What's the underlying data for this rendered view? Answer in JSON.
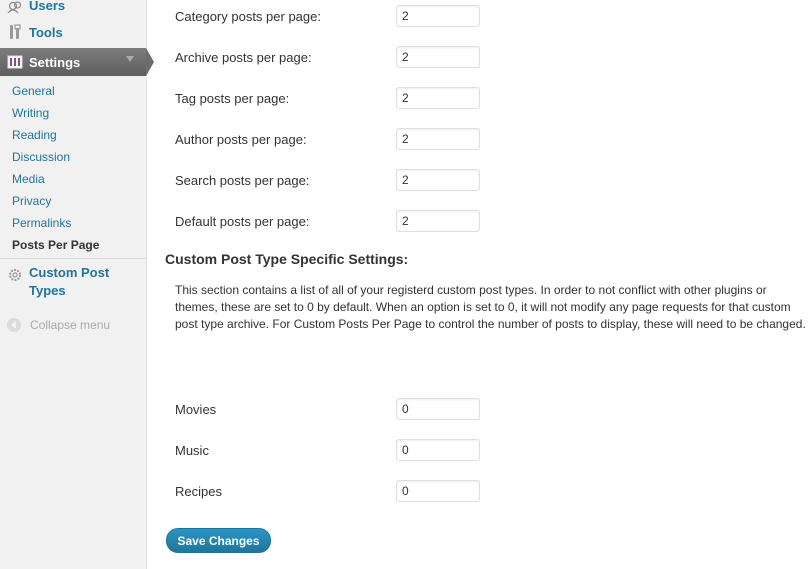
{
  "sidebar": {
    "users_label": "Users",
    "tools_label": "Tools",
    "settings_label": "Settings",
    "submenu": [
      {
        "label": "General",
        "current": false
      },
      {
        "label": "Writing",
        "current": false
      },
      {
        "label": "Reading",
        "current": false
      },
      {
        "label": "Discussion",
        "current": false
      },
      {
        "label": "Media",
        "current": false
      },
      {
        "label": "Privacy",
        "current": false
      },
      {
        "label": "Permalinks",
        "current": false
      },
      {
        "label": "Posts Per Page",
        "current": true
      }
    ],
    "custom_post_types_label": "Custom Post Types",
    "collapse_label": "Collapse menu",
    "icons": {
      "users": "users-icon",
      "tools": "tools-icon",
      "settings": "settings-icon",
      "custom_post_types": "gear-icon",
      "collapse": "collapse-arrow-icon"
    }
  },
  "settings_rows": [
    {
      "label": "Category posts per page:",
      "value": "2"
    },
    {
      "label": "Archive posts per page:",
      "value": "2"
    },
    {
      "label": "Tag posts per page:",
      "value": "2"
    },
    {
      "label": "Author posts per page:",
      "value": "2"
    },
    {
      "label": "Search posts per page:",
      "value": "2"
    },
    {
      "label": "Default posts per page:",
      "value": "2"
    }
  ],
  "custom_section": {
    "heading": "Custom Post Type Specific Settings:",
    "description": "This section contains a list of all of your registerd custom post types. In order to not conflict with other plugins or themes, these are set to 0 by default. When an option is set to 0, it will not modify any page requests for that custom post type archive. For Custom Posts Per Page to control the number of posts to display, these will need to be changed."
  },
  "custom_rows": [
    {
      "label": "Movies",
      "value": "0"
    },
    {
      "label": "Music",
      "value": "0"
    },
    {
      "label": "Recipes",
      "value": "0"
    }
  ],
  "save_label": "Save Changes",
  "colors": {
    "link": "#21759b",
    "sidebar_bg": "#f1f1f1",
    "settings_active_bg": "#6c6c6c",
    "button_bg": "#21759b"
  }
}
